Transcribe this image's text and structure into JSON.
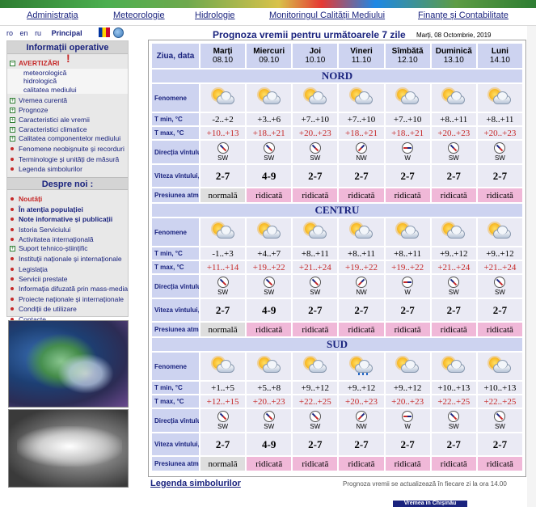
{
  "topnav": [
    "Administrația",
    "Meteorologie",
    "Hidrologie",
    "Monitoringul Calității Mediului",
    "Finanțe și Contabilitate"
  ],
  "lang": {
    "ro": "ro",
    "en": "en",
    "ru": "ru",
    "home": "Principal"
  },
  "sidebar": {
    "head1": "Informații operative",
    "warnings": "AVERTIZĂRI",
    "warn_subs": [
      "meteorologică",
      "hidrologică",
      "calitatea mediului"
    ],
    "items": [
      "Vremea curentă",
      "Prognoze",
      "Caracteristici ale vremii",
      "Caracteristici climatice",
      "Calitatea componentelor mediului"
    ],
    "bullets": [
      "Fenomene neobișnuite și recorduri",
      "Terminologie și unități de măsură",
      "Legenda simbolurilor"
    ],
    "head2": "Despre noi :",
    "about": [
      "Noutăți",
      "În atenția populației",
      "Note informative și publicații",
      "Istoria Serviciului",
      "Activitatea internațională",
      "Suport tehnico-științific",
      "Instituții naționale și internaționale",
      "Legislația",
      "Servicii prestate",
      "Informația difuzată prin mass-media",
      "Proiecte naționale și internaționale",
      "Condiții de utilizare",
      "Contacte"
    ]
  },
  "main": {
    "title": "Prognoza vremii pentru următoarele 7 zile",
    "date": "Marți, 08 Octombrie, 2019",
    "header_label": "Ziua, data",
    "days": [
      {
        "name": "Marți",
        "date": "08.10"
      },
      {
        "name": "Miercuri",
        "date": "09.10"
      },
      {
        "name": "Joi",
        "date": "10.10"
      },
      {
        "name": "Vineri",
        "date": "11.10"
      },
      {
        "name": "Sîmbătă",
        "date": "12.10"
      },
      {
        "name": "Duminică",
        "date": "13.10"
      },
      {
        "name": "Luni",
        "date": "14.10"
      }
    ],
    "row_labels": {
      "phen": "Fenomene",
      "tmin": "T min, °C",
      "tmax": "T max, °C",
      "dir": "Direcția vîntului",
      "speed": "Viteza vîntului, m/s",
      "press": "Presiunea atmosferică"
    },
    "regions": [
      {
        "name": "NORD",
        "icons": [
          "sun-cloud",
          "sun-cloud",
          "sun-cloud",
          "sun-cloud",
          "sun-cloud",
          "sun-cloud",
          "sun-cloud"
        ],
        "tmin": [
          "-2..+2",
          "+3..+6",
          "+7..+10",
          "+7..+10",
          "+7..+10",
          "+8..+11",
          "+8..+11"
        ],
        "tmax": [
          "+10..+13",
          "+18..+21",
          "+20..+23",
          "+18..+21",
          "+18..+21",
          "+20..+23",
          "+20..+23"
        ],
        "dir": [
          "SW",
          "SW",
          "SW",
          "NW",
          "W",
          "SW",
          "SW"
        ],
        "speed": [
          "2-7",
          "4-9",
          "2-7",
          "2-7",
          "2-7",
          "2-7",
          "2-7"
        ],
        "press": [
          "normală",
          "ridicată",
          "ridicată",
          "ridicată",
          "ridicată",
          "ridicată",
          "ridicată"
        ]
      },
      {
        "name": "CENTRU",
        "icons": [
          "sun-cloud",
          "sun-cloud",
          "sun-cloud",
          "sun-cloud",
          "sun-cloud",
          "sun-cloud",
          "sun-cloud"
        ],
        "tmin": [
          "-1..+3",
          "+4..+7",
          "+8..+11",
          "+8..+11",
          "+8..+11",
          "+9..+12",
          "+9..+12"
        ],
        "tmax": [
          "+11..+14",
          "+19..+22",
          "+21..+24",
          "+19..+22",
          "+19..+22",
          "+21..+24",
          "+21..+24"
        ],
        "dir": [
          "SW",
          "SW",
          "SW",
          "NW",
          "W",
          "SW",
          "SW"
        ],
        "speed": [
          "2-7",
          "4-9",
          "2-7",
          "2-7",
          "2-7",
          "2-7",
          "2-7"
        ],
        "press": [
          "normală",
          "ridicată",
          "ridicată",
          "ridicată",
          "ridicată",
          "ridicată",
          "ridicată"
        ]
      },
      {
        "name": "SUD",
        "icons": [
          "sun-cloud",
          "sun-cloud",
          "sun-cloud",
          "sun-cloud-rain",
          "sun-cloud",
          "sun-cloud",
          "sun-cloud"
        ],
        "tmin": [
          "+1..+5",
          "+5..+8",
          "+9..+12",
          "+9..+12",
          "+9..+12",
          "+10..+13",
          "+10..+13"
        ],
        "tmax": [
          "+12..+15",
          "+20..+23",
          "+22..+25",
          "+20..+23",
          "+20..+23",
          "+22..+25",
          "+22..+25"
        ],
        "dir": [
          "SW",
          "SW",
          "SW",
          "NW",
          "W",
          "SW",
          "SW"
        ],
        "speed": [
          "2-7",
          "4-9",
          "2-7",
          "2-7",
          "2-7",
          "2-7",
          "2-7"
        ],
        "press": [
          "normală",
          "ridicată",
          "ridicată",
          "ridicată",
          "ridicată",
          "ridicată",
          "ridicată"
        ]
      }
    ]
  },
  "footer": {
    "legend": "Legenda simbolurilor",
    "note": "Prognoza vremii se actualizează în fiecare zi la ora 14.00",
    "city_button": "Vremea în Chișinău"
  }
}
